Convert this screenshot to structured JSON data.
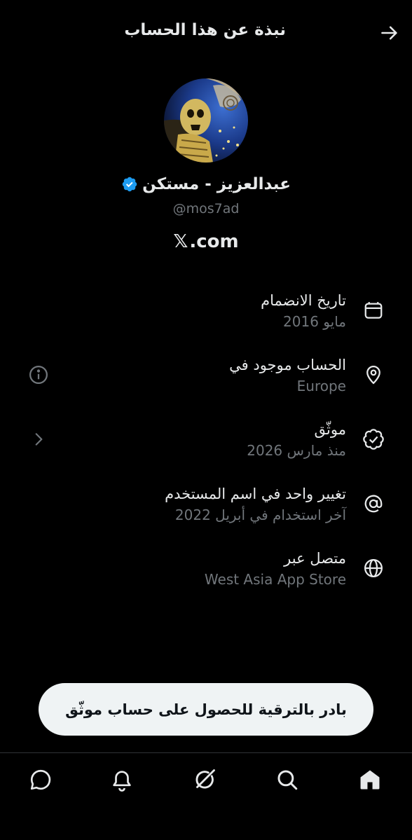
{
  "header": {
    "title": "نبذة عن هذا الحساب",
    "back_icon": "arrow-right-icon"
  },
  "profile": {
    "display_name": "عبدالعزيز - مستكن",
    "handle": "@mos7ad",
    "verified": true,
    "verified_color": "#1d9bf0",
    "site_logo": "𝕏",
    "site_domain": ".com"
  },
  "info": [
    {
      "icon": "calendar-icon",
      "title": "تاريخ الانضمام",
      "value": "مايو 2016"
    },
    {
      "icon": "location-pin-icon",
      "title": "الحساب موجود في",
      "value": "Europe",
      "side_icon": "info-circle-icon"
    },
    {
      "icon": "verified-check-icon",
      "title": "موثّق",
      "value": "منذ مارس 2026",
      "side_icon": "chevron-left-icon"
    },
    {
      "icon": "at-sign-icon",
      "title": "تغيير واحد في اسم المستخدم",
      "value": "آخر استخدام في أبريل 2022"
    },
    {
      "icon": "globe-icon",
      "title": "متصل عبر",
      "value": "West Asia App Store"
    }
  ],
  "upgrade_button": {
    "label": "بادر بالترقية للحصول على حساب موثّق"
  },
  "bottom_nav": [
    {
      "icon": "chat-bubble-icon"
    },
    {
      "icon": "bell-icon"
    },
    {
      "icon": "grok-icon"
    },
    {
      "icon": "search-icon"
    },
    {
      "icon": "home-icon"
    }
  ],
  "colors": {
    "background": "#000000",
    "primary_text": "#e7e9ea",
    "secondary_text": "#71767b",
    "divider": "#2f3336",
    "button_bg": "#eff3f4"
  }
}
